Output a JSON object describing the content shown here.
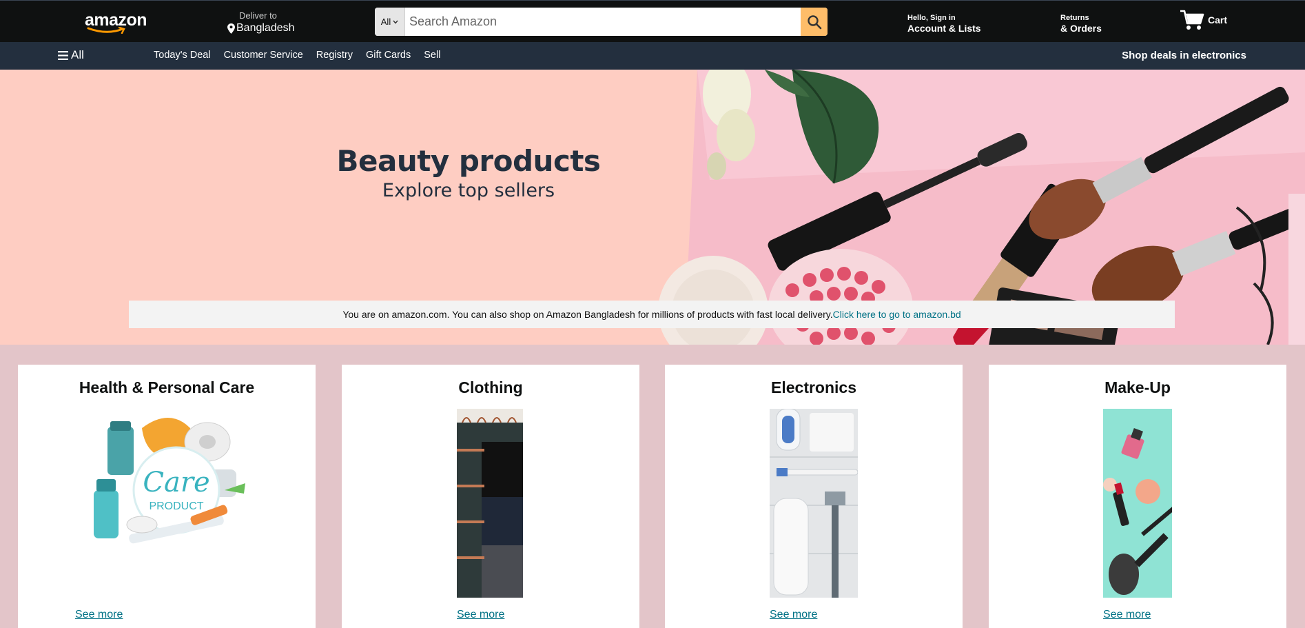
{
  "header": {
    "logo_text": "amazon",
    "deliver_label": "Deliver to",
    "deliver_location": "Bangladesh",
    "search": {
      "category": "All",
      "placeholder": "Search Amazon"
    },
    "account_line1": "Hello, Sign in",
    "account_line2": "Account & Lists",
    "returns_line1": "Returns",
    "returns_line2": "& Orders",
    "cart_label": "Cart"
  },
  "subnav": {
    "all_label": "All",
    "links": [
      "Today's Deal",
      "Customer Service",
      "Registry",
      "Gift Cards",
      "Sell"
    ],
    "deals_label": "Shop deals in electronics"
  },
  "hero": {
    "title": "Beauty products",
    "subtitle": "Explore top sellers",
    "notice_text": "You are on amazon.com. You can also shop on Amazon Bangladesh for millions of products with fast local delivery.",
    "notice_link": "Click here to go to amazon.bd"
  },
  "cards": [
    {
      "title": "Health & Personal Care",
      "image_label": "Care",
      "image_sublabel": "PRODUCT",
      "link": "See more"
    },
    {
      "title": "Clothing",
      "link": "See more"
    },
    {
      "title": "Electronics",
      "link": "See more"
    },
    {
      "title": "Make-Up",
      "link": "See more"
    }
  ],
  "colors": {
    "nav_bg": "#0f1111",
    "subnav_bg": "#232f3e",
    "search_button": "#febd69",
    "hero_bg": "#fecdc2",
    "page_bg": "#e3c5c9",
    "link": "#007185"
  }
}
